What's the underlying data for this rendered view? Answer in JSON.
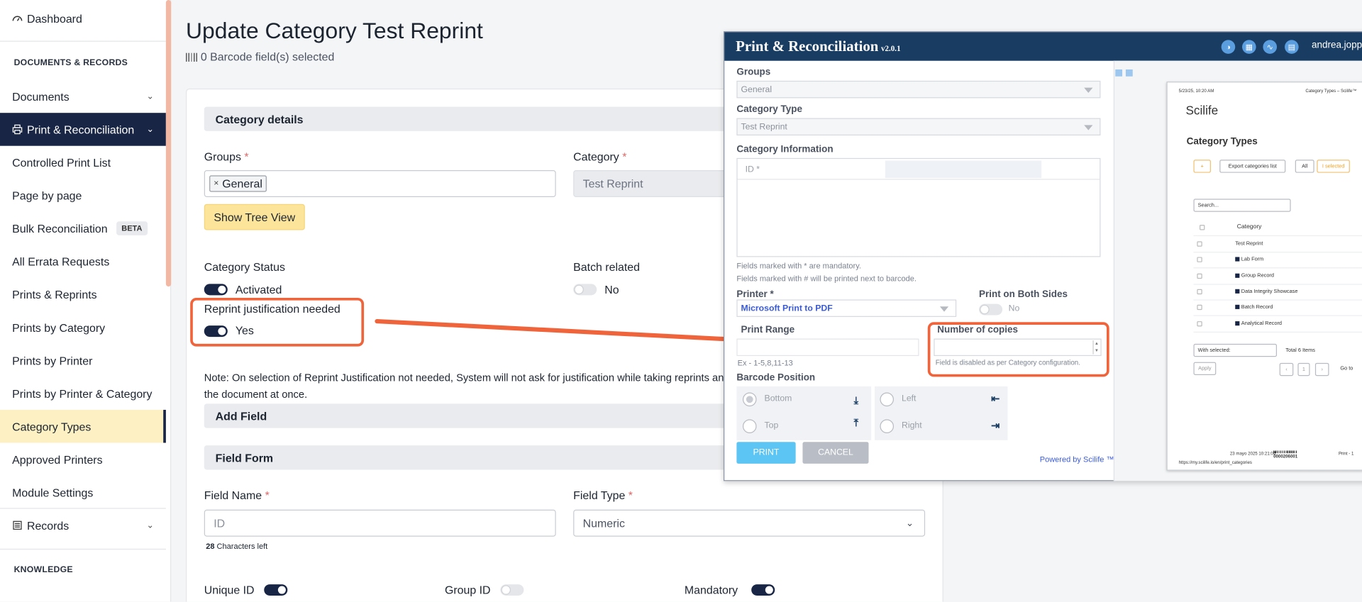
{
  "sidebar": {
    "dashboard": "Dashboard",
    "section_docs": "DOCUMENTS & RECORDS",
    "documents": "Documents",
    "print_recon": "Print & Reconciliation",
    "items": [
      "Controlled Print List",
      "Page by page",
      "Bulk Reconciliation",
      "All Errata Requests",
      "Prints & Reprints",
      "Prints by Category",
      "Prints by Printer",
      "Prints by Printer & Category",
      "Category Types",
      "Approved Printers",
      "Module Settings"
    ],
    "beta": "BETA",
    "records": "Records",
    "section_knowledge": "KNOWLEDGE"
  },
  "page": {
    "title": "Update Category Test Reprint",
    "subtitle": "0 Barcode field(s) selected"
  },
  "form": {
    "category_details": "Category details",
    "groups_label": "Groups",
    "groups_chip": "General",
    "category_label": "Category",
    "category_value": "Test Reprint",
    "show_tree": "Show Tree View",
    "status_label": "Category Status",
    "status_value": "Activated",
    "batch_label": "Batch related",
    "batch_value": "No",
    "reprint_label": "Reprint justification needed",
    "reprint_value": "Yes",
    "note_line1": "Note: On selection of Reprint Justification not needed, System will not ask for justification while taking reprints and",
    "note_line2": "the document at once.",
    "add_field": "Add Field",
    "field_form": "Field Form",
    "field_name_label": "Field Name",
    "field_name_placeholder": "ID",
    "chars_left_num": "28",
    "chars_left_txt": "Characters left",
    "field_type_label": "Field Type",
    "field_type_value": "Numeric",
    "unique_id": "Unique ID",
    "group_id": "Group ID",
    "mandatory": "Mandatory",
    "asterisk": "*"
  },
  "modal": {
    "title": "Print & Reconciliation",
    "version": "v2.0.1",
    "user": "andrea.joppic",
    "groups_label": "Groups",
    "groups_value": "General",
    "cat_type_label": "Category Type",
    "cat_type_value": "Test Reprint",
    "cat_info_label": "Category Information",
    "id_label": "ID *",
    "note1": "Fields marked with * are mandatory.",
    "note2": "Fields marked with # will be printed next to barcode.",
    "printer_label": "Printer *",
    "printer_value": "Microsoft Print to PDF",
    "both_sides_label": "Print on Both Sides",
    "both_sides_value": "No",
    "range_label": "Print Range",
    "range_hint": "Ex - 1-5,8,11-13",
    "copies_label": "Number of copies",
    "copies_hint": "Field is disabled as per  Category configuration.",
    "barcode_label": "Barcode Position",
    "bottom": "Bottom",
    "top": "Top",
    "left": "Left",
    "right": "Right",
    "print": "PRINT",
    "cancel": "CANCEL",
    "powered": "Powered by Scilife ™"
  },
  "preview": {
    "date": "5/23/25, 10:20 AM",
    "header_right": "Category Types – Scilife™",
    "brand": "Scilife",
    "heading": "Category Types",
    "plus": "+",
    "export": "Export categories list",
    "all": "All",
    "selected": "I selected",
    "search": "Search...",
    "col": "Category",
    "rows": [
      "Test Reprint",
      "Lab Form",
      "Group Record",
      "Data Integrity Showcase",
      "Batch Record",
      "Analytical Record"
    ],
    "with_selected": "With selected:",
    "total": "Total 6 Items",
    "apply": "Apply",
    "goto": "Go to",
    "page": "1",
    "footer_date": "23 mayo 2025 10:21:04",
    "footer_code": "0000206001",
    "footer_right": "Print - 1",
    "url": "https://my.scilife.io/en/print_categories"
  },
  "colors": {
    "navy": "#182545",
    "accent": "#f0643c",
    "yellow": "#fce49a",
    "modal_head": "#193c63"
  }
}
